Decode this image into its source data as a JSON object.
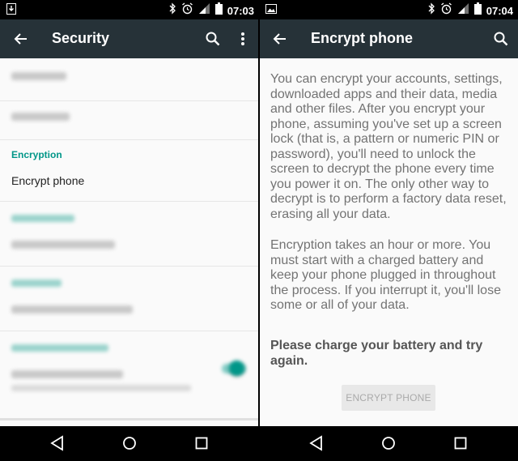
{
  "left": {
    "status": {
      "time": "07:03"
    },
    "appbar": {
      "title": "Security",
      "back_icon": "arrow-back-icon",
      "search_icon": "search-icon",
      "more_icon": "more-vert-icon"
    },
    "list": {
      "encryption_header": "Encryption",
      "encrypt_phone": "Encrypt phone"
    },
    "toggle_color": "#009688"
  },
  "right": {
    "status": {
      "time": "07:04"
    },
    "appbar": {
      "title": "Encrypt phone",
      "back_icon": "arrow-back-icon",
      "search_icon": "search-icon"
    },
    "body": {
      "paragraph1": "You can encrypt your accounts, settings, downloaded apps and their data, media and other files. After you encrypt your phone, assuming you've set up a screen lock (that is, a pattern or numeric PIN or password), you'll need to unlock the screen to decrypt the phone every time you power it on. The only other way to decrypt is to perform a factory data reset, erasing all your data.",
      "paragraph2": "Encryption takes an hour or more. You must start with a charged battery and keep your phone plugged in throughout the process. If you interrupt it, you'll lose some or all of your data.",
      "warning": "Please charge your battery and try again.",
      "button": "ENCRYPT PHONE"
    }
  },
  "colors": {
    "appbar": "#263238",
    "accent": "#009688"
  }
}
